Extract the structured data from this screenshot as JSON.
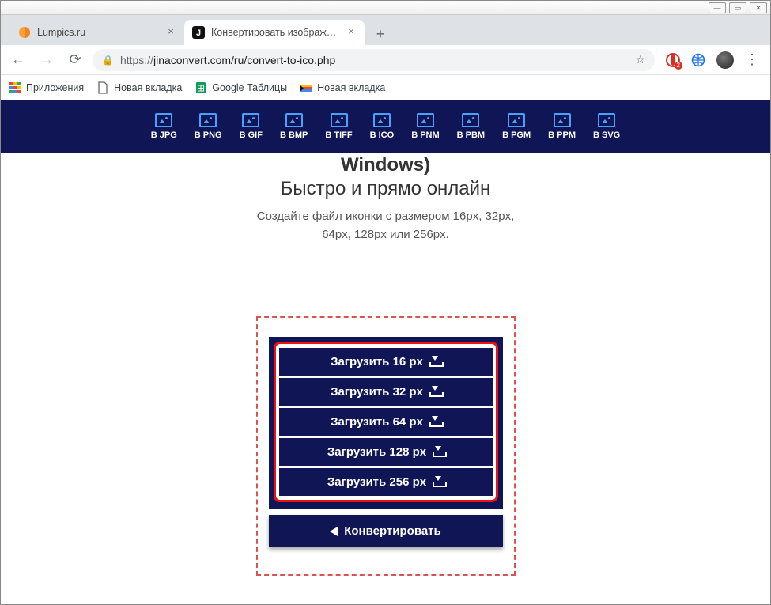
{
  "window": {
    "tabs": [
      {
        "title": "Lumpics.ru",
        "active": false
      },
      {
        "title": "Конвертировать изображения",
        "active": true
      }
    ]
  },
  "addressbar": {
    "scheme": "https://",
    "host_path": "jinaconvert.com/ru/convert-to-ico.php",
    "opera_badge": "2"
  },
  "bookmarks": [
    {
      "label": "Приложения",
      "icon": "apps"
    },
    {
      "label": "Новая вкладка",
      "icon": "page"
    },
    {
      "label": "Google Таблицы",
      "icon": "sheets"
    },
    {
      "label": "Новая вкладка",
      "icon": "chromatic"
    }
  ],
  "sitenav": {
    "formats": [
      "В JPG",
      "В PNG",
      "В GIF",
      "В BMP",
      "В TIFF",
      "В ICO",
      "В PNM",
      "В PBM",
      "В PGM",
      "В PPM",
      "В SVG"
    ]
  },
  "headline": {
    "title_cut": "Windows)",
    "subtitle": "Быстро и прямо онлайн",
    "desc_line1": "Создайте файл иконки с размером 16px, 32px,",
    "desc_line2": "64px, 128px или 256px."
  },
  "dropzone": {
    "buttons": [
      "Загрузить 16 px",
      "Загрузить 32 px",
      "Загрузить 64 px",
      "Загрузить 128 px",
      "Загрузить 256 px"
    ],
    "convert": "Конвертировать"
  }
}
